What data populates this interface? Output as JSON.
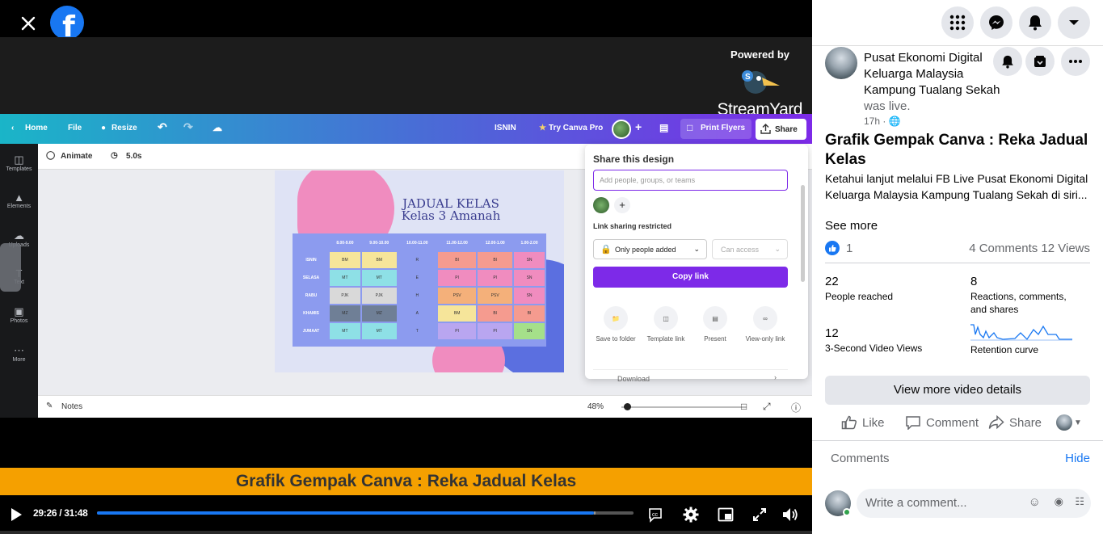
{
  "video": {
    "powered_by": "Powered by",
    "streamyard": "StreamYard",
    "caption": "Grafik Gempak Canva : Reka Jadual Kelas",
    "time": "29:26 / 31:48",
    "progress_fraction": 0.926
  },
  "canva": {
    "nav": {
      "home": "Home",
      "file": "File",
      "resize": "Resize",
      "page_name": "ISNIN",
      "try_pro": "Try Canva Pro",
      "print": "Print Flyers",
      "share": "Share"
    },
    "toolbar": {
      "animate": "Animate",
      "duration": "5.0s"
    },
    "sidebar": [
      "Templates",
      "Elements",
      "Uploads",
      "Text",
      "Photos",
      "More"
    ],
    "page_title_line1": "JADUAL KELAS",
    "page_title_line2": "Kelas 3 Amanah",
    "table": {
      "headers": [
        "",
        "8.00-9.00",
        "9.00-10.00",
        "10.00-11.00",
        "11.00-12.00",
        "12.00-1.00",
        "1.00-2.00"
      ],
      "rows": [
        {
          "day": "ISNIN",
          "cells": [
            "BM",
            "BM",
            "R",
            "BI",
            "BI",
            "SN"
          ],
          "colors": [
            "#f6e59a",
            "#f6e59a",
            "#8c9bef",
            "#f59b8f",
            "#f59b8f",
            "#f08cbf"
          ]
        },
        {
          "day": "SELASA",
          "cells": [
            "MT",
            "MT",
            "E",
            "PI",
            "PI",
            "SN"
          ],
          "colors": [
            "#8ee0e6",
            "#8ee0e6",
            "#8c9bef",
            "#f08cbf",
            "#f08cbf",
            "#f08cbf"
          ]
        },
        {
          "day": "RABU",
          "cells": [
            "PJK",
            "PJK",
            "H",
            "PSV",
            "PSV",
            "SN"
          ],
          "colors": [
            "#d9d9d9",
            "#d9d9d9",
            "#8c9bef",
            "#f4b07a",
            "#f4b07a",
            "#f08cbf"
          ]
        },
        {
          "day": "KHAMIS",
          "cells": [
            "MZ",
            "MZ",
            "A",
            "BM",
            "BI",
            "BI"
          ],
          "colors": [
            "#6f7f96",
            "#6f7f96",
            "#8c9bef",
            "#f6e59a",
            "#f59b8f",
            "#f59b8f"
          ]
        },
        {
          "day": "JUMAAT",
          "cells": [
            "MT",
            "MT",
            "T",
            "PI",
            "PI",
            "SN"
          ],
          "colors": [
            "#8ee0e6",
            "#8ee0e6",
            "#8c9bef",
            "#b9a6f0",
            "#b9a6f0",
            "#a5e08a"
          ]
        }
      ]
    },
    "notes": "Notes",
    "zoom": "48%",
    "share_popup": {
      "title": "Share this design",
      "placeholder": "Add people, groups, or teams",
      "restricted": "Link sharing restricted",
      "only_people": "Only people added",
      "can_access": "Can access",
      "copy_link": "Copy link",
      "options": [
        "Save to folder",
        "Template link",
        "Present",
        "View-only link"
      ],
      "download": "Download"
    }
  },
  "panel": {
    "poster_name": "Pusat Ekonomi Digital Keluarga Malaysia Kampung Tualang Sekah",
    "was_live": "was live.",
    "time": "17h ·",
    "title": "Grafik Gempak Canva : Reka Jadual Kelas",
    "description": "Ketahui lanjut melalui FB Live Pusat Ekonomi Digital Keluarga Malaysia Kampung Tualang Sekah di siri...",
    "see_more": "See more",
    "reaction_count": "1",
    "comments_views": "4 Comments  12 Views",
    "stats": [
      {
        "num": "22",
        "label": "People reached"
      },
      {
        "num": "8",
        "label": "Reactions, comments, and shares"
      },
      {
        "num": "12",
        "label": "3-Second Video Views"
      },
      {
        "num": "",
        "label": "Retention curve"
      }
    ],
    "view_more": "View more video details",
    "actions": {
      "like": "Like",
      "comment": "Comment",
      "share": "Share"
    },
    "comments_label": "Comments",
    "hide": "Hide",
    "comment_placeholder": "Write a comment..."
  }
}
